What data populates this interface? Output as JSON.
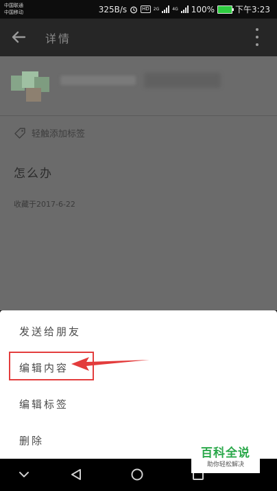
{
  "status_bar": {
    "carrier_1": "中国联通",
    "carrier_2": "中国移动",
    "net_speed": "325B/s",
    "hd_badge": "HD",
    "net_type_1": "2G",
    "net_type_2": "4G",
    "battery_percent": "100%",
    "time": "下午3:23",
    "battery_color": "#2ecc40"
  },
  "app_bar": {
    "title": "详情",
    "back_icon": "arrow-left-icon",
    "more_icon": "more-vertical-icon"
  },
  "content": {
    "add_tag_label": "轻触添加标签",
    "tag_icon": "tag-icon",
    "note_text": "怎么办",
    "saved_label": "收藏于2017-6-22"
  },
  "menu": {
    "items": [
      {
        "label": "发送给朋友"
      },
      {
        "label": "编辑内容"
      },
      {
        "label": "编辑标签"
      },
      {
        "label": "删除"
      }
    ],
    "highlight_color": "#e33c3c"
  },
  "nav_bar": {
    "icons": [
      "chevron-down-icon",
      "triangle-back-icon",
      "circle-home-icon",
      "square-recent-icon"
    ]
  },
  "watermark": {
    "title": "百科全说",
    "subtitle": "助你轻松解决",
    "color": "#2aa84a"
  }
}
